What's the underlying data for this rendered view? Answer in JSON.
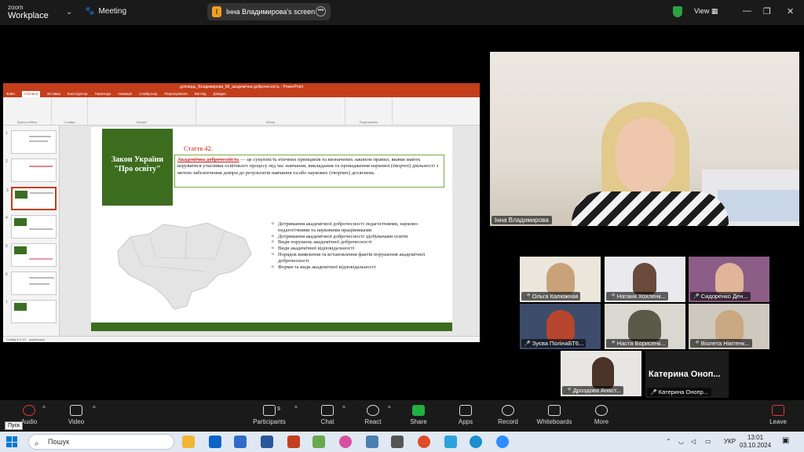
{
  "topbar": {
    "brand_top": "zoom",
    "brand_bottom": "Workplace",
    "meeting_label": "Meeting",
    "share_badge": "I",
    "share_label": "Інна Владимирова's screen",
    "view_label": "View"
  },
  "ppt": {
    "title": "доповідь_Владимирова_МІ_академічна доброчесність  -  PowerPoint",
    "menu": [
      "Файл",
      "Головна",
      "Вставка",
      "Конструктор",
      "Переходи",
      "Анімація",
      "Слайд-шоу",
      "Рецензування",
      "Вигляд",
      "Довідка"
    ],
    "ribbon_groups": [
      "Буфер обміну",
      "Слайди",
      "Шрифт",
      "Абзац",
      "Редагування"
    ],
    "status_left": "Слайд 3 із 13",
    "status_lang": "українська",
    "slide": {
      "green_title": "Закон України \"Про освіту\"",
      "article": "Стаття 42.",
      "def_term": "Академічна доброчесність",
      "def_text": " — це сукупність етичних принципів та визначених законом правил, якими мають керуватися учасники освітнього процесу під час навчання, викладання та провадження наукової (творчої) діяльності з метою забезпечення довіри до результатів навчання та/або наукових (творчих) досягнень.",
      "list": [
        "Дотримання академічної доброчесності педагогічними, науково-педагогічними та науковими працівниками",
        "Дотримання академічної доброчесності здобувачами освіти",
        "Види порушень академічної доброчесності",
        "Види академічної відповідальності",
        "Порядок виявлення та встановлення фактів порушення академічної доброчесності",
        "Форми та види академічної відповідальності"
      ]
    }
  },
  "main_video": {
    "name": "Інна Владимирова"
  },
  "gallery": [
    {
      "name": "Ольга Калюжная",
      "muted": true
    },
    {
      "name": "Натаня Хохленк...",
      "muted": true
    },
    {
      "name": "Сидоренко Ден...",
      "muted": true
    },
    {
      "name": "Зуєва ПолінаБТ6...",
      "muted": true
    },
    {
      "name": "Настя Борисенк...",
      "muted": true
    },
    {
      "name": "Віолета Нікітенк...",
      "muted": true
    },
    {
      "name": "Дроздова Анаст...",
      "muted": true
    }
  ],
  "big_name": {
    "display": "Катерина Оноп...",
    "label": "Катерина Онопр..."
  },
  "toolbar": {
    "audio": "Audio",
    "video": "Video",
    "participants": "Participants",
    "participants_count": "9",
    "chat": "Chat",
    "react": "React",
    "share": "Share",
    "apps": "Apps",
    "record": "Record",
    "whiteboards": "Whiteboards",
    "more": "More",
    "leave": "Leave",
    "tooltip": "Пуск"
  },
  "taskbar": {
    "search": "Пошук",
    "lang": "УКР",
    "time": "13:01",
    "date": "03.10.2024"
  },
  "colors": {
    "ppt_red": "#c43e1c",
    "slide_green": "#3c6d1f",
    "share_green": "#1fb141",
    "mute_red": "#e53935"
  }
}
